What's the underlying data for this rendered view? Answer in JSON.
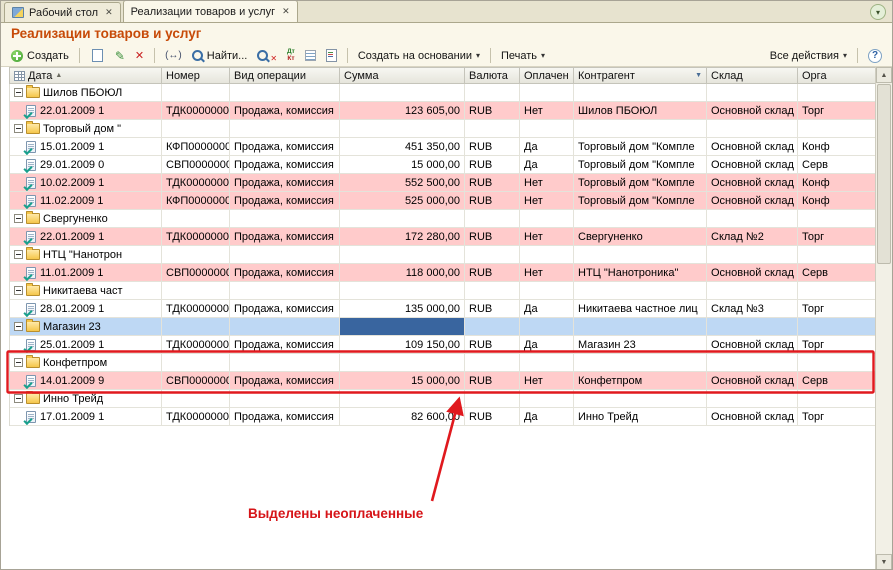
{
  "window": {
    "tabs": [
      {
        "label": "Рабочий стол"
      },
      {
        "label": "Реализации товаров и услуг"
      }
    ],
    "title": "Реализации товаров и услуг"
  },
  "toolbar": {
    "create_label": "Создать",
    "find_label": "Найти...",
    "create_based_on_label": "Создать на основании",
    "print_label": "Печать",
    "all_actions_label": "Все действия"
  },
  "icons": {
    "close": "✕",
    "dropdown": "▾",
    "sort_asc": "▲",
    "filter": "▼",
    "period": "(↔)",
    "dt": "Дт",
    "kt": "Кт",
    "help": "?",
    "pencil": "✎",
    "delete_x": "✕",
    "cancel_x": "✕",
    "scroll_up": "▲",
    "scroll_down": "▼"
  },
  "table": {
    "columns": [
      {
        "label": "Дата",
        "sorted": true
      },
      {
        "label": "Номер"
      },
      {
        "label": "Вид операции"
      },
      {
        "label": "Сумма"
      },
      {
        "label": "Валюта"
      },
      {
        "label": "Оплачен"
      },
      {
        "label": "Контрагент",
        "filtered": true
      },
      {
        "label": "Склад"
      },
      {
        "label": "Орга"
      }
    ],
    "rows": [
      {
        "type": "group",
        "name": "Шилов ПБОЮЛ"
      },
      {
        "type": "data",
        "unpaid": true,
        "date": "22.01.2009 1",
        "number": "ТДК0000000",
        "operation": "Продажа, комиссия",
        "sum": "123 605,00",
        "currency": "RUB",
        "paid": "Нет",
        "counterparty": "Шилов ПБОЮЛ",
        "warehouse": "Основной склад",
        "org": "Торг"
      },
      {
        "type": "group",
        "name": "Торговый дом \""
      },
      {
        "type": "data",
        "date": "15.01.2009 1",
        "number": "КФП0000000",
        "operation": "Продажа, комиссия",
        "sum": "451 350,00",
        "currency": "RUB",
        "paid": "Да",
        "counterparty": "Торговый дом \"Компле",
        "warehouse": "Основной склад",
        "org": "Конф"
      },
      {
        "type": "data",
        "date": "29.01.2009 0",
        "number": "СВП0000000",
        "operation": "Продажа, комиссия",
        "sum": "15 000,00",
        "currency": "RUB",
        "paid": "Да",
        "counterparty": "Торговый дом \"Компле",
        "warehouse": "Основной склад",
        "org": "Серв"
      },
      {
        "type": "data",
        "unpaid": true,
        "date": "10.02.2009 1",
        "number": "ТДК0000000",
        "operation": "Продажа, комиссия",
        "sum": "552 500,00",
        "currency": "RUB",
        "paid": "Нет",
        "counterparty": "Торговый дом \"Компле",
        "warehouse": "Основной склад",
        "org": "Конф"
      },
      {
        "type": "data",
        "unpaid": true,
        "date": "11.02.2009 1",
        "number": "КФП0000000",
        "operation": "Продажа, комиссия",
        "sum": "525 000,00",
        "currency": "RUB",
        "paid": "Нет",
        "counterparty": "Торговый дом \"Компле",
        "warehouse": "Основной склад",
        "org": "Конф"
      },
      {
        "type": "group",
        "name": "Свергуненко"
      },
      {
        "type": "data",
        "unpaid": true,
        "date": "22.01.2009 1",
        "number": "ТДК0000000",
        "operation": "Продажа, комиссия",
        "sum": "172 280,00",
        "currency": "RUB",
        "paid": "Нет",
        "counterparty": "Свергуненко",
        "warehouse": "Склад №2",
        "org": "Торг"
      },
      {
        "type": "group",
        "name": "НТЦ \"Нанотрон"
      },
      {
        "type": "data",
        "unpaid": true,
        "date": "11.01.2009 1",
        "number": "СВП0000000",
        "operation": "Продажа, комиссия",
        "sum": "118 000,00",
        "currency": "RUB",
        "paid": "Нет",
        "counterparty": "НТЦ \"Нанотроника\"",
        "warehouse": "Основной склад",
        "org": "Серв"
      },
      {
        "type": "group",
        "name": "Никитаева част"
      },
      {
        "type": "data",
        "date": "28.01.2009 1",
        "number": "ТДК0000000",
        "operation": "Продажа, комиссия",
        "sum": "135 000,00",
        "currency": "RUB",
        "paid": "Да",
        "counterparty": "Никитаева частное лиц",
        "warehouse": "Склад №3",
        "org": "Торг"
      },
      {
        "type": "group",
        "name": "Магазин 23",
        "selected": true
      },
      {
        "type": "data",
        "date": "25.01.2009 1",
        "number": "ТДК0000000",
        "operation": "Продажа, комиссия",
        "sum": "109 150,00",
        "currency": "RUB",
        "paid": "Да",
        "counterparty": "Магазин 23",
        "warehouse": "Основной склад",
        "org": "Торг"
      },
      {
        "type": "group",
        "name": "Конфетпром",
        "outlined": true
      },
      {
        "type": "data",
        "unpaid": true,
        "outlined": true,
        "date": "14.01.2009 9",
        "number": "СВП0000000",
        "operation": "Продажа, комиссия",
        "sum": "15 000,00",
        "currency": "RUB",
        "paid": "Нет",
        "counterparty": "Конфетпром",
        "warehouse": "Основной склад",
        "org": "Серв"
      },
      {
        "type": "group",
        "name": "Инно Трейд"
      },
      {
        "type": "data",
        "date": "17.01.2009 1",
        "number": "ТДК0000000",
        "operation": "Продажа, комиссия",
        "sum": "82 600,00",
        "currency": "RUB",
        "paid": "Да",
        "counterparty": "Инно Трейд",
        "warehouse": "Основной склад",
        "org": "Торг"
      }
    ]
  },
  "annotation": {
    "text": "Выделены неоплаченные"
  },
  "colors": {
    "title": "#c74a08",
    "unpaid_row": "#ffcbcb",
    "selected_row": "#bed8f4",
    "focused_cell": "#39659f",
    "annotation": "#d61418"
  }
}
